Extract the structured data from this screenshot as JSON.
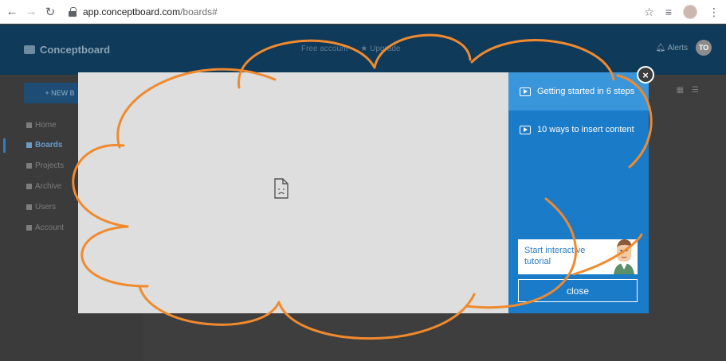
{
  "browser": {
    "url_host": "app.conceptboard.com",
    "url_path": "/boards#"
  },
  "header": {
    "logo": "Conceptboard",
    "free_account": "Free account",
    "upgrade": "Upgrade",
    "alerts": "Alerts",
    "avatar_initials": "TO"
  },
  "sidebar": {
    "new_button": "+ NEW B",
    "items": [
      {
        "label": "Home"
      },
      {
        "label": "Boards"
      },
      {
        "label": "Projects"
      },
      {
        "label": "Archive"
      },
      {
        "label": "Users"
      },
      {
        "label": "Account"
      }
    ]
  },
  "modal": {
    "lessons": [
      {
        "label": "Getting started in 6 steps"
      },
      {
        "label": "10 ways to insert content"
      }
    ],
    "tutorial_button": "Start interactive tutorial",
    "close_button": "close",
    "close_x": "×"
  },
  "colors": {
    "accent_blue": "#1a7bc8",
    "active_lesson": "#3a96db",
    "annotation": "#f08a2e",
    "header_bg": "#0f3a59"
  }
}
